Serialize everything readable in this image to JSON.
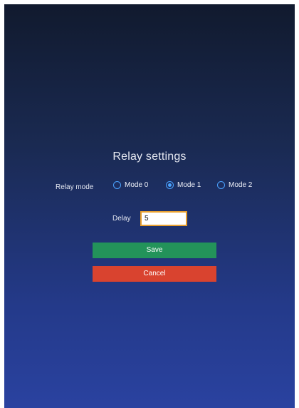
{
  "dialog": {
    "title": "Relay settings"
  },
  "relay_mode": {
    "label": "Relay mode",
    "options": [
      {
        "label": "Mode 0",
        "selected": false
      },
      {
        "label": "Mode 1",
        "selected": true
      },
      {
        "label": "Mode 2",
        "selected": false
      }
    ]
  },
  "delay": {
    "label": "Delay",
    "value": "5"
  },
  "buttons": {
    "save_label": "Save",
    "cancel_label": "Cancel"
  },
  "colors": {
    "radio_accent": "#4aa3ff",
    "save": "#23935a",
    "cancel": "#d9432f",
    "input_border": "#e8a030"
  }
}
